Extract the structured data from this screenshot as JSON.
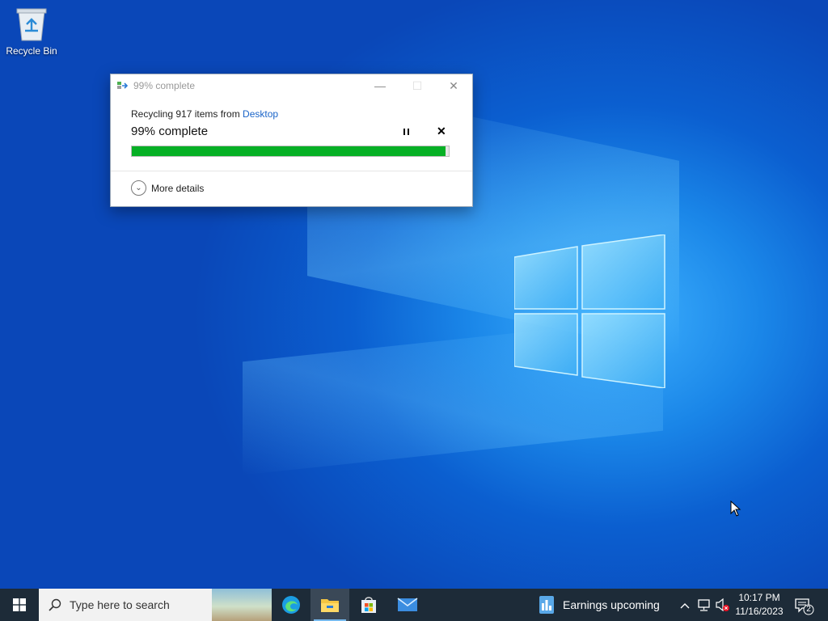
{
  "desktop": {
    "recycle_bin_label": "Recycle Bin"
  },
  "dialog": {
    "title": "99% complete",
    "line_prefix": "Recycling 917 items from ",
    "line_link": "Desktop",
    "percent_text": "99% complete",
    "progress": 0.99,
    "more_details": "More details"
  },
  "taskbar": {
    "search_placeholder": "Type here to search",
    "apps": [
      "edge-icon",
      "file-explorer-icon",
      "store-icon",
      "mail-icon"
    ],
    "news_text": "Earnings upcoming",
    "time": "10:17 PM",
    "date": "11/16/2023",
    "notification_count": "2"
  },
  "colors": {
    "accent": "#1a64c8",
    "progress": "#06b025",
    "taskbar": "#1d2b38"
  }
}
